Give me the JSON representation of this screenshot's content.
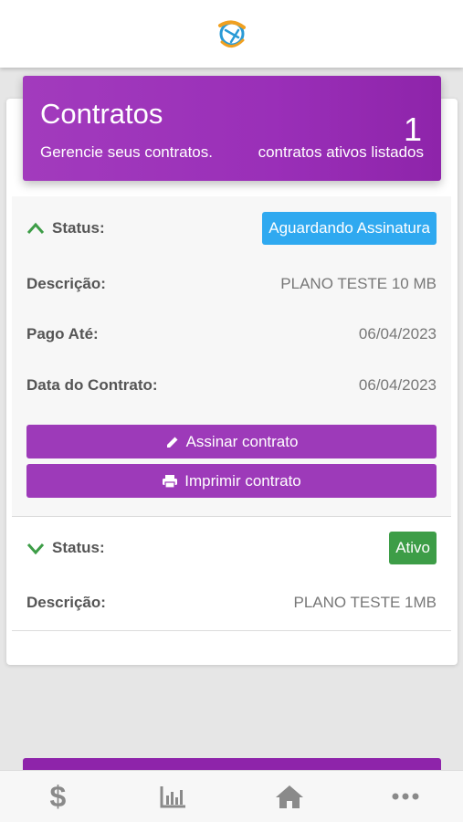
{
  "header": {
    "title": "Contratos",
    "subtitle": "Gerencie seus contratos.",
    "count": "1",
    "count_label": "contratos ativos listados"
  },
  "contracts": [
    {
      "status_label": "Status:",
      "status": "Aguardando Assinatura",
      "status_color": "#2fa9f0",
      "expanded": true,
      "fields": [
        {
          "label": "Descrição:",
          "value": "PLANO TESTE 10 MB"
        },
        {
          "label": "Pago Até:",
          "value": "06/04/2023"
        },
        {
          "label": "Data do Contrato:",
          "value": "06/04/2023"
        }
      ],
      "actions": {
        "sign": "Assinar contrato",
        "print": "Imprimir contrato"
      }
    },
    {
      "status_label": "Status:",
      "status": "Ativo",
      "status_color": "#3d9d47",
      "expanded": false,
      "fields": [
        {
          "label": "Descrição:",
          "value": "PLANO TESTE 1MB"
        }
      ]
    }
  ],
  "nav": {
    "items": [
      {
        "icon": "dollar-icon",
        "glyph": "$"
      },
      {
        "icon": "chart-icon"
      },
      {
        "icon": "home-icon"
      },
      {
        "icon": "more-icon"
      }
    ]
  },
  "colors": {
    "accent": "#9d3ab9",
    "header_gradient_end": "#8e24aa",
    "chevron": "#3d9d47"
  }
}
